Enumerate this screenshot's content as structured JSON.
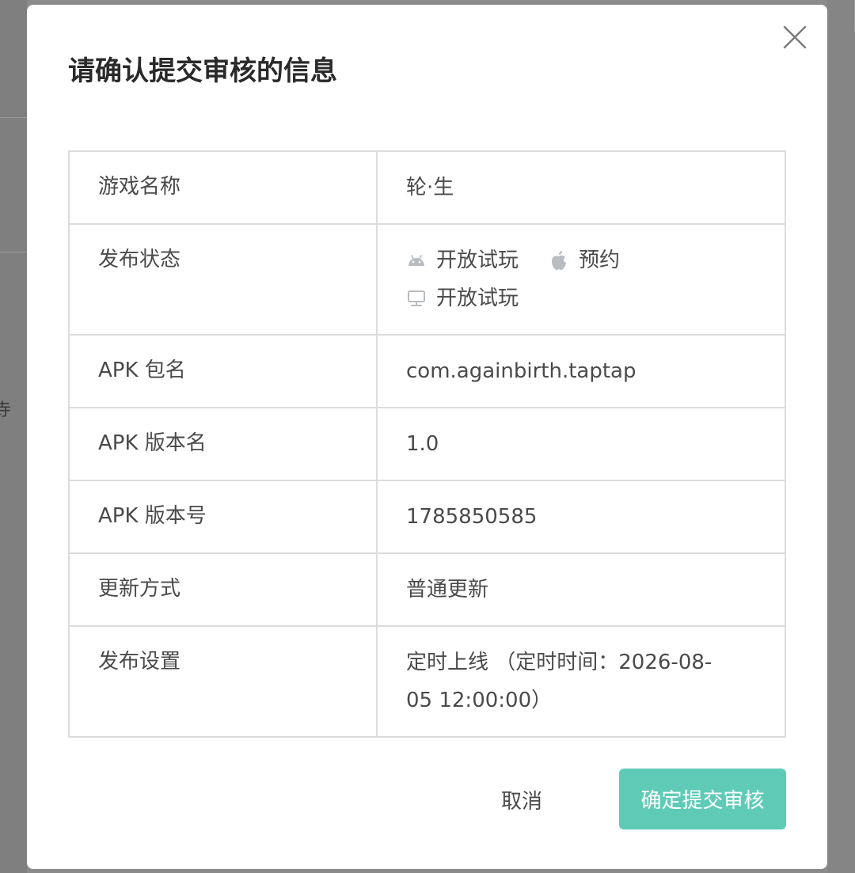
{
  "background": {
    "partial_text": "寺"
  },
  "dialog": {
    "title": "请确认提交审核的信息",
    "close_icon": "close-icon"
  },
  "rows": [
    {
      "label": "游戏名称",
      "value": "轮·生"
    },
    {
      "label": "发布状态"
    },
    {
      "label": "APK 包名",
      "value": "com.againbirth.taptap"
    },
    {
      "label": "APK 版本名",
      "value": "1.0"
    },
    {
      "label": "APK 版本号",
      "value": "1785850585"
    },
    {
      "label": "更新方式",
      "value": "普通更新"
    },
    {
      "label": "发布设置",
      "value_line1": "定时上线 （定时时间：2026-08-",
      "value_line2": "05 12:00:00）"
    }
  ],
  "publish_status": {
    "android": {
      "icon": "android-icon",
      "text": "开放试玩"
    },
    "ios": {
      "icon": "apple-icon",
      "text": "预约"
    },
    "pc": {
      "icon": "pc-icon",
      "text": "开放试玩"
    }
  },
  "buttons": {
    "cancel": "取消",
    "submit": "确定提交审核"
  },
  "colors": {
    "primary": "#5fcbb7",
    "overlay": "#8a8a8a",
    "border": "#dcdcdc",
    "text": "#4a4a4a"
  }
}
